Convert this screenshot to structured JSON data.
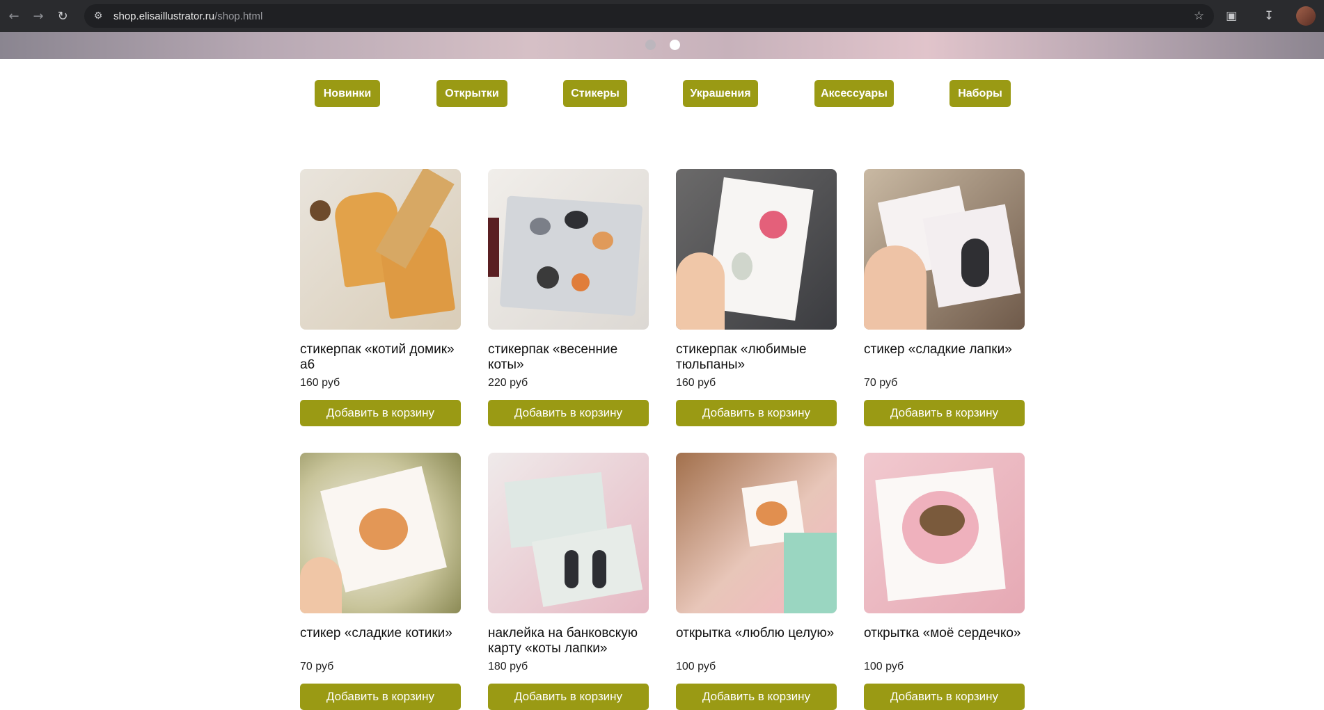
{
  "browser": {
    "url_host": "shop.elisaillustrator.ru",
    "url_path": "/shop.html",
    "icons": [
      "back-arrow-icon",
      "forward-arrow-icon",
      "reload-icon",
      "site-info-icon",
      "star-icon",
      "extensions-icon",
      "download-icon",
      "profile-avatar"
    ]
  },
  "slider": {
    "dots": 2,
    "active": 2
  },
  "categories": [
    {
      "label": "Новинки"
    },
    {
      "label": "Открытки"
    },
    {
      "label": "Стикеры"
    },
    {
      "label": "Украшения"
    },
    {
      "label": "Аксессуары"
    },
    {
      "label": "Наборы"
    }
  ],
  "products": [
    {
      "title": "стикерпак «котий домик» а6",
      "price": "160 руб",
      "button": "Добавить в корзину"
    },
    {
      "title": "стикерпак «весенние коты»",
      "price": "220 руб",
      "button": "Добавить в корзину"
    },
    {
      "title": "стикерпак «любимые тюльпаны»",
      "price": "160 руб",
      "button": "Добавить в корзину"
    },
    {
      "title": "стикер «сладкие лапки»",
      "price": "70 руб",
      "button": "Добавить в корзину"
    },
    {
      "title": "стикер «сладкие котики»",
      "price": "70 руб",
      "button": "Добавить в корзину"
    },
    {
      "title": "наклейка на банковскую карту «коты лапки»",
      "price": "180 руб",
      "button": "Добавить в корзину"
    },
    {
      "title": "открытка «люблю целую»",
      "price": "100 руб",
      "button": "Добавить в корзину"
    },
    {
      "title": "открытка «моё сердечко»",
      "price": "100 руб",
      "button": "Добавить в корзину"
    }
  ],
  "colors": {
    "accent": "#9a9a14",
    "chrome": "#2a2b2e"
  }
}
